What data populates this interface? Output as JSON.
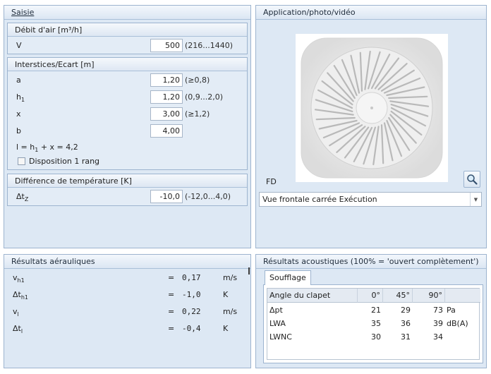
{
  "saisie": {
    "title": "Saisie",
    "debit": {
      "header": "Débit d'air [m³/h]",
      "label": "V",
      "value": "500",
      "range": "(216...1440)"
    },
    "interstices": {
      "header": "Interstices/Ecart [m]",
      "a": {
        "label": "a",
        "value": "1,20",
        "range": "(≥0,8)"
      },
      "h1": {
        "label": "h",
        "sub": "1",
        "value": "1,20",
        "range": "(0,9...2,0)"
      },
      "x": {
        "label": "x",
        "value": "3,00",
        "range": "(≥1,2)"
      },
      "b": {
        "label": "b",
        "value": "4,00"
      },
      "formula_prefix": "l = h",
      "formula_sub": "1",
      "formula_suffix": " + x = 4,2",
      "checkbox_label": "Disposition 1 rang"
    },
    "temperature": {
      "header": "Différence de température [K]",
      "label": "Δt",
      "sub": "Z",
      "value": "-10,0",
      "range": "(-12,0...4,0)"
    }
  },
  "application": {
    "title": "Application/photo/vidéo",
    "product_code": "FD",
    "view_select": "Vue frontale carrée Exécution",
    "zoom_icon": "magnifier-icon"
  },
  "aero": {
    "title": "Résultats aérauliques",
    "rows": [
      {
        "name": "v",
        "sub": "h1",
        "eq": "=",
        "value": "0,17",
        "unit": "m/s"
      },
      {
        "name": "Δt",
        "sub": "h1",
        "eq": "=",
        "value": "-1,0",
        "unit": "K"
      },
      {
        "name": "v",
        "sub": "l",
        "eq": "=",
        "value": "0,22",
        "unit": "m/s"
      },
      {
        "name": "Δt",
        "sub": "l",
        "eq": "=",
        "value": "-0,4",
        "unit": "K"
      }
    ]
  },
  "acoustic": {
    "title": "Résultats acoustiques (100% = 'ouvert complètement')",
    "tab": "Soufflage",
    "columns": [
      "Angle du clapet",
      "0°",
      "45°",
      "90°"
    ],
    "rows": [
      {
        "label": "Δpt",
        "v0": "21",
        "v45": "29",
        "v90": "73",
        "unit": "Pa"
      },
      {
        "label": "LWA",
        "v0": "35",
        "v45": "36",
        "v90": "39",
        "unit": "dB(A)"
      },
      {
        "label": "LWNC",
        "v0": "30",
        "v45": "31",
        "v90": "34",
        "unit": ""
      }
    ]
  },
  "colors": {
    "panel_bg": "#dde8f4",
    "panel_border": "#9db4cf"
  }
}
